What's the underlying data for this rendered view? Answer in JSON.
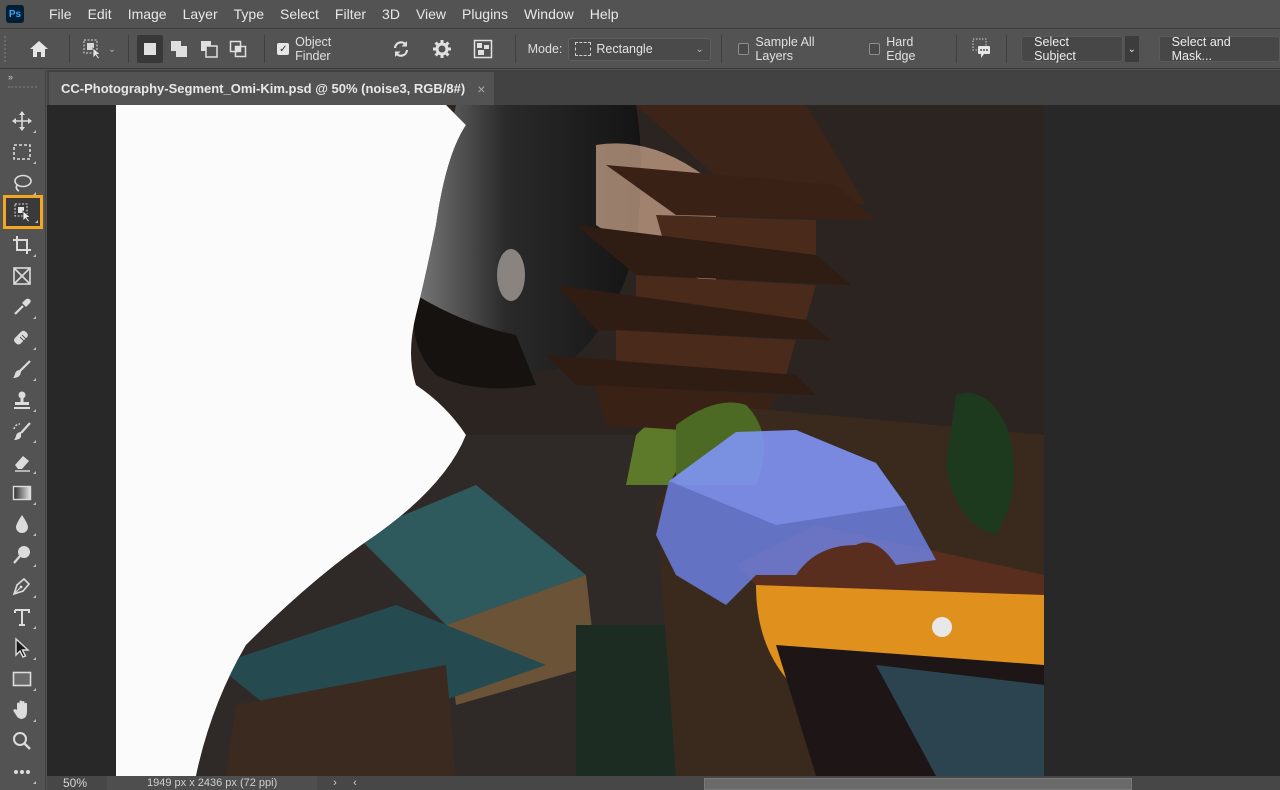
{
  "app": {
    "logo": "Ps",
    "menu": [
      "File",
      "Edit",
      "Image",
      "Layer",
      "Type",
      "Select",
      "Filter",
      "3D",
      "View",
      "Plugins",
      "Window",
      "Help"
    ]
  },
  "options_bar": {
    "home_icon": "home-icon",
    "tool_preset_icon": "object-selection-icon",
    "selection_modes": [
      "new-selection",
      "add-to-selection",
      "subtract-from-selection",
      "intersect-with-selection"
    ],
    "active_mode": "new-selection",
    "object_finder": {
      "label": "Object Finder",
      "checked": true
    },
    "refresh_icon": "refresh-icon",
    "settings_icon": "gear-icon",
    "show_all_objects_icon": "show-all-objects-icon",
    "mode": {
      "label": "Mode:",
      "value": "Rectangle"
    },
    "sample_all_layers": {
      "label": "Sample All Layers",
      "checked": false
    },
    "hard_edge": {
      "label": "Hard Edge",
      "checked": false
    },
    "feedback_icon": "feedback-icon",
    "select_subject": "Select Subject",
    "select_and_mask": "Select and Mask..."
  },
  "document": {
    "tab_title": "CC-Photography-Segment_Omi-Kim.psd @ 50% (noise3, RGB/8#)",
    "close": "×"
  },
  "toolbar": {
    "collapse": "››",
    "selected_tool": "object-selection-tool",
    "tools": [
      "move-tool",
      "rectangular-marquee-tool",
      "lasso-tool",
      "object-selection-tool",
      "crop-tool",
      "frame-tool",
      "eyedropper-tool",
      "spot-healing-brush-tool",
      "brush-tool",
      "clone-stamp-tool",
      "history-brush-tool",
      "eraser-tool",
      "gradient-tool",
      "blur-tool",
      "dodge-tool",
      "pen-tool",
      "type-tool",
      "path-selection-tool",
      "rectangle-tool",
      "hand-tool",
      "zoom-tool",
      "edit-toolbar"
    ]
  },
  "canvas": {
    "highlight_color": "#6f86f2",
    "accent_color": "#f5a623"
  },
  "status": {
    "zoom": "50%",
    "doc_info": "1949 px x 2436 px (72 ppi)",
    "next_arrow": "›",
    "prev_arrow": "‹"
  }
}
